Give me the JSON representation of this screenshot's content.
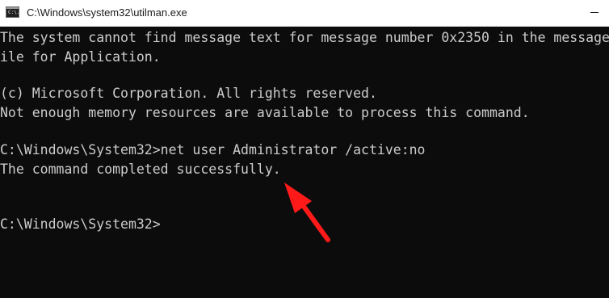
{
  "window": {
    "title": "C:\\Windows\\system32\\utilman.exe",
    "icon_label": "C:\\."
  },
  "console": {
    "lines": [
      "The system cannot find message text for message number 0x2350 in the message f",
      "ile for Application.",
      "",
      "(c) Microsoft Corporation. All rights reserved.",
      "Not enough memory resources are available to process this command.",
      "",
      "C:\\Windows\\System32>net user Administrator /active:no",
      "The command completed successfully.",
      "",
      "",
      "C:\\Windows\\System32>"
    ],
    "text_color": "#cccccc",
    "background_color": "#0c0c0c"
  },
  "annotation": {
    "arrow_color": "#ff1a1a",
    "arrow_icon": "red-arrow-icon"
  }
}
